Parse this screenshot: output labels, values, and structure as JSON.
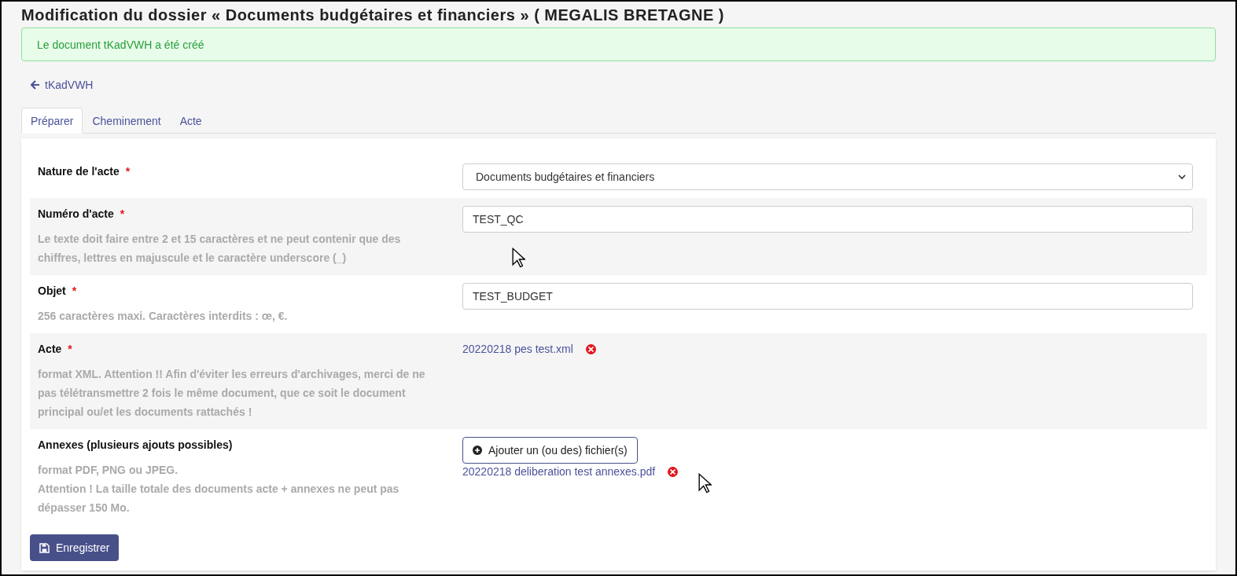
{
  "page_title": "Modification du dossier « Documents budgétaires et financiers » ( MEGALIS BRETAGNE )",
  "alert": {
    "kind": "success",
    "text": "Le document tKadVWH a été créé"
  },
  "back_link": "tKadVWH",
  "tabs": [
    {
      "label": "Préparer",
      "selected": true
    },
    {
      "label": "Cheminement",
      "selected": false
    },
    {
      "label": "Acte",
      "selected": false
    }
  ],
  "fields": [
    {
      "kind": "select",
      "label": "Nature de l'acte",
      "required_mark": "*",
      "value": "Documents budgétaires et financiers"
    },
    {
      "kind": "text",
      "label": "Numéro d'acte",
      "required_mark": "*",
      "help": [
        "Le texte doit faire entre 2 et 15 caractères et ne peut contenir que des chiffres, lettres en majuscule et le caractère underscore (_)"
      ],
      "value": "TEST_QC"
    },
    {
      "kind": "text",
      "label": "Objet",
      "required_mark": "*",
      "help": [
        "256 caractères maxi. Caractères interdits : œ, €."
      ],
      "value": "TEST_BUDGET"
    },
    {
      "kind": "file",
      "label": "Acte",
      "required_mark": "*",
      "help": [
        "format XML. Attention !! Afin d'éviter les erreurs d'archivages, merci de ne pas télétransmettre 2 fois le même document, que ce soit le document principal ou/et les documents rattachés !"
      ],
      "files": [
        "20220218 pes test.xml"
      ]
    },
    {
      "kind": "files",
      "label": "Annexes (plusieurs ajouts possibles)",
      "help": [
        "format PDF, PNG ou JPEG.",
        "Attention ! La taille totale des documents acte + annexes ne peut pas dépasser 150 Mo."
      ],
      "button": "Ajouter un (ou des) fichier(s)",
      "files": [
        "20220218 deliberation test annexes.pdf"
      ]
    }
  ],
  "save_button": "Enregistrer"
}
